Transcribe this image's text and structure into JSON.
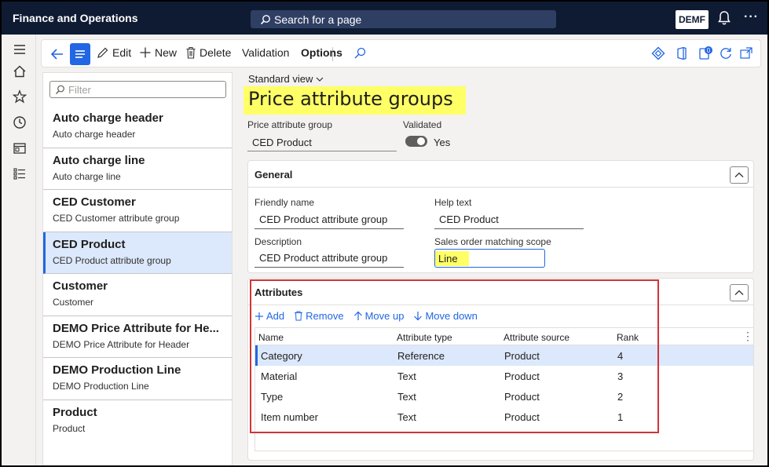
{
  "topbar": {
    "app_title": "Finance and Operations",
    "search_placeholder": "Search for a page",
    "company": "DEMF",
    "more": "···"
  },
  "actionbar": {
    "edit": "Edit",
    "new": "New",
    "delete": "Delete",
    "validation": "Validation",
    "options": "Options",
    "notification_count": "0"
  },
  "left": {
    "filter_placeholder": "Filter",
    "items": [
      {
        "title": "Auto charge header",
        "subtitle": "Auto charge header"
      },
      {
        "title": "Auto charge line",
        "subtitle": "Auto charge line"
      },
      {
        "title": "CED Customer",
        "subtitle": "CED Customer attribute group"
      },
      {
        "title": "CED Product",
        "subtitle": "CED Product attribute group",
        "selected": true
      },
      {
        "title": "Customer",
        "subtitle": "Customer"
      },
      {
        "title": "DEMO Price Attribute for He...",
        "subtitle": "DEMO Price Attribute for Header"
      },
      {
        "title": "DEMO Production Line",
        "subtitle": "DEMO Production Line"
      },
      {
        "title": "Product",
        "subtitle": "Product"
      }
    ]
  },
  "main": {
    "standard_view": "Standard view",
    "title": "Price attribute groups",
    "header": {
      "group_label": "Price attribute group",
      "group_value": "CED Product",
      "validated_label": "Validated",
      "validated_value": "Yes"
    },
    "general": {
      "title": "General",
      "friendly_name_label": "Friendly name",
      "friendly_name_value": "CED Product attribute group",
      "help_text_label": "Help text",
      "help_text_value": "CED Product",
      "description_label": "Description",
      "description_value": "CED Product attribute group",
      "scope_label": "Sales order matching scope",
      "scope_value": "Line"
    },
    "attributes": {
      "title": "Attributes",
      "toolbar": {
        "add": "Add",
        "remove": "Remove",
        "move_up": "Move up",
        "move_down": "Move down"
      },
      "columns": [
        "Name",
        "Attribute type",
        "Attribute source",
        "Rank"
      ],
      "rows": [
        [
          "Category",
          "Reference",
          "Product",
          "4"
        ],
        [
          "Material",
          "Text",
          "Product",
          "3"
        ],
        [
          "Type",
          "Text",
          "Product",
          "2"
        ],
        [
          "Item number",
          "Text",
          "Product",
          "1"
        ]
      ]
    }
  },
  "colors": {
    "topbar": "#0f1b33",
    "accent": "#2266e3",
    "highlight": "#ffff66",
    "annotation_red": "#d13438",
    "selection": "#dce8fb"
  }
}
